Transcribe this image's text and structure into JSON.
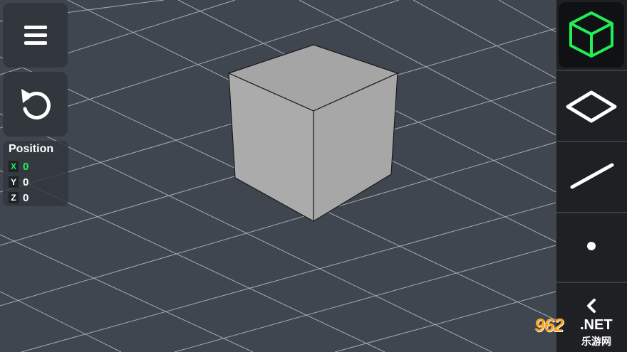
{
  "colors": {
    "background": "#3f4650",
    "grid_line": "#c9cdd2",
    "cube_front": "#a9a9a9",
    "cube_top": "#a5a5a5",
    "toolbar": "#1e2024",
    "selected_tool_accent": "#22ee55"
  },
  "left_panel": {
    "menu_icon": "hamburger-menu-icon",
    "reset_icon": "rotate-reset-icon",
    "position": {
      "title": "Position",
      "axes": [
        {
          "label": "X",
          "value": "0",
          "active": true
        },
        {
          "label": "Y",
          "value": "0",
          "active": false
        },
        {
          "label": "Z",
          "value": "0",
          "active": false
        }
      ]
    }
  },
  "toolbar": {
    "tools": [
      {
        "name": "cube-mode",
        "icon": "cube-outline-icon",
        "selected": true
      },
      {
        "name": "face-mode",
        "icon": "diamond-face-icon",
        "selected": false
      },
      {
        "name": "edge-mode",
        "icon": "line-edge-icon",
        "selected": false
      },
      {
        "name": "vertex-mode",
        "icon": "dot-vertex-icon",
        "selected": false
      },
      {
        "name": "collapse",
        "icon": "chevron-left-icon",
        "selected": false
      }
    ]
  },
  "watermark": {
    "number": "962",
    "domain": ".NET",
    "subtitle": "乐游网"
  }
}
